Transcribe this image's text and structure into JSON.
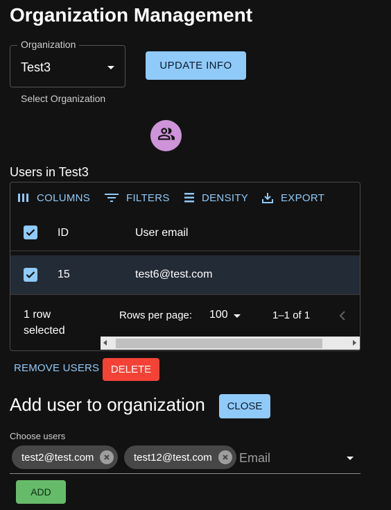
{
  "page": {
    "title": "Organization Management"
  },
  "organization": {
    "label": "Organization",
    "selected": "Test3",
    "helper": "Select Organization",
    "update_label": "UPDATE INFO",
    "avatar_icon": "group-icon"
  },
  "users_section": {
    "title": "Users in Test3",
    "toolbar": {
      "columns": "COLUMNS",
      "filters": "FILTERS",
      "density": "DENSITY",
      "export": "EXPORT"
    },
    "columns": [
      "ID",
      "User email"
    ],
    "rows": [
      {
        "id": "15",
        "email": "test6@test.com",
        "selected": true
      }
    ],
    "footer": {
      "selected_line1": "1 row",
      "selected_line2": "selected",
      "rows_per_page_label": "Rows per page:",
      "rows_per_page_value": "100",
      "range": "1–1 of 1"
    },
    "remove_label": "REMOVE USERS",
    "delete_label": "DELETE"
  },
  "add_user": {
    "title": "Add user to organization",
    "close_label": "CLOSE",
    "choose_label": "Choose users",
    "chips": [
      "test2@test.com",
      "test12@test.com"
    ],
    "placeholder": "Email",
    "add_label": "ADD"
  },
  "colors": {
    "background": "#121212",
    "primary": "#90caf9",
    "error": "#f44336",
    "success": "#66bb6a",
    "avatar": "#ce93d8",
    "selected_row": "#232b36"
  }
}
